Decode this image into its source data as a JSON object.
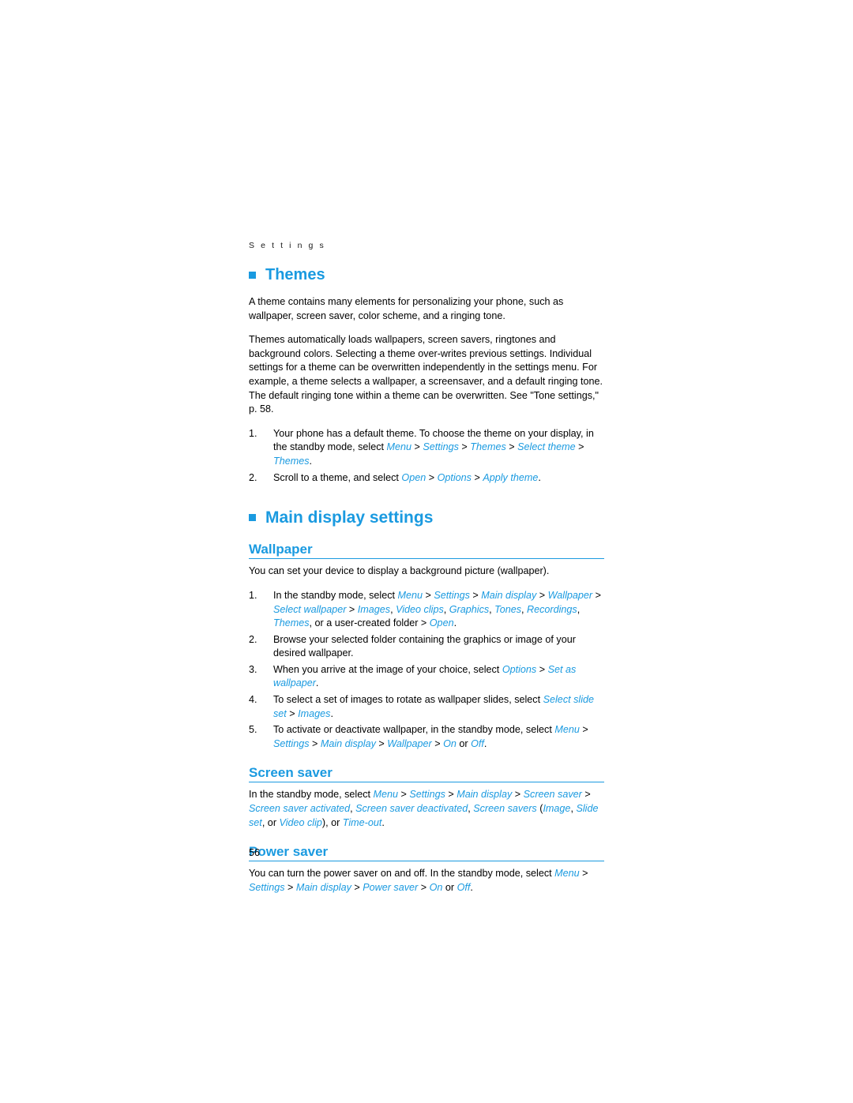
{
  "page": {
    "running_head": "S e t t i n g s",
    "page_number": "56",
    "accent_color": "#1a9ae0"
  },
  "themes": {
    "heading": "Themes",
    "para1": "A theme contains many elements for personalizing your phone, such as wallpaper, screen saver, color scheme, and a ringing tone.",
    "para2": "Themes automatically loads wallpapers, screen savers, ringtones and background colors. Selecting a theme over-writes previous settings. Individual settings for a theme can be overwritten independently in the settings menu. For example, a theme selects a wallpaper, a screensaver, and a default ringing tone. The default ringing tone within a theme can be overwritten. See \"Tone settings,\" p. 58.",
    "steps": [
      {
        "num": "1.",
        "parts": [
          {
            "t": "Your phone has a default theme. To choose the theme on your display, in the standby mode, select ",
            "style": "plain"
          },
          {
            "t": "Menu",
            "style": "link"
          },
          {
            "t": " > ",
            "style": "plain"
          },
          {
            "t": "Settings",
            "style": "link"
          },
          {
            "t": " > ",
            "style": "plain"
          },
          {
            "t": "Themes",
            "style": "link"
          },
          {
            "t": " > ",
            "style": "plain"
          },
          {
            "t": "Select theme",
            "style": "link"
          },
          {
            "t": " > ",
            "style": "plain"
          },
          {
            "t": "Themes",
            "style": "link"
          },
          {
            "t": ".",
            "style": "plain"
          }
        ]
      },
      {
        "num": "2.",
        "parts": [
          {
            "t": "Scroll to a theme, and select ",
            "style": "plain"
          },
          {
            "t": "Open",
            "style": "link"
          },
          {
            "t": " > ",
            "style": "plain"
          },
          {
            "t": "Options",
            "style": "link"
          },
          {
            "t": " > ",
            "style": "plain"
          },
          {
            "t": "Apply theme",
            "style": "link"
          },
          {
            "t": ".",
            "style": "plain"
          }
        ]
      }
    ]
  },
  "main_display": {
    "heading": "Main display settings",
    "wallpaper": {
      "heading": "Wallpaper",
      "para1": "You can set your device to display a background picture (wallpaper).",
      "steps": [
        {
          "num": "1.",
          "parts": [
            {
              "t": "In the standby mode, select ",
              "style": "plain"
            },
            {
              "t": "Menu",
              "style": "link"
            },
            {
              "t": " > ",
              "style": "plain"
            },
            {
              "t": "Settings",
              "style": "link"
            },
            {
              "t": " > ",
              "style": "plain"
            },
            {
              "t": "Main display",
              "style": "link"
            },
            {
              "t": " > ",
              "style": "plain"
            },
            {
              "t": "Wallpaper",
              "style": "link"
            },
            {
              "t": " > ",
              "style": "plain"
            },
            {
              "t": "Select wallpaper",
              "style": "link"
            },
            {
              "t": " > ",
              "style": "plain"
            },
            {
              "t": "Images",
              "style": "link"
            },
            {
              "t": ", ",
              "style": "plain"
            },
            {
              "t": "Video clips",
              "style": "link"
            },
            {
              "t": ", ",
              "style": "plain"
            },
            {
              "t": "Graphics",
              "style": "link"
            },
            {
              "t": ", ",
              "style": "plain"
            },
            {
              "t": "Tones",
              "style": "link"
            },
            {
              "t": ", ",
              "style": "plain"
            },
            {
              "t": "Recordings",
              "style": "link"
            },
            {
              "t": ", ",
              "style": "plain"
            },
            {
              "t": "Themes",
              "style": "link"
            },
            {
              "t": ", or a user-created folder > ",
              "style": "plain"
            },
            {
              "t": "Open",
              "style": "link"
            },
            {
              "t": ".",
              "style": "plain"
            }
          ]
        },
        {
          "num": "2.",
          "parts": [
            {
              "t": "Browse your selected folder containing the graphics or image of your desired wallpaper.",
              "style": "plain"
            }
          ]
        },
        {
          "num": "3.",
          "parts": [
            {
              "t": "When you arrive at the image of your choice, select ",
              "style": "plain"
            },
            {
              "t": "Options",
              "style": "link"
            },
            {
              "t": " > ",
              "style": "plain"
            },
            {
              "t": "Set as wallpaper",
              "style": "link"
            },
            {
              "t": ".",
              "style": "plain"
            }
          ]
        },
        {
          "num": "4.",
          "parts": [
            {
              "t": "To select a set of images to rotate as wallpaper slides, select ",
              "style": "plain"
            },
            {
              "t": "Select slide set",
              "style": "link"
            },
            {
              "t": " > ",
              "style": "plain"
            },
            {
              "t": "Images",
              "style": "link"
            },
            {
              "t": ".",
              "style": "plain"
            }
          ]
        },
        {
          "num": "5.",
          "parts": [
            {
              "t": "To activate or deactivate wallpaper, in the standby mode, select ",
              "style": "plain"
            },
            {
              "t": "Menu",
              "style": "link"
            },
            {
              "t": " > ",
              "style": "plain"
            },
            {
              "t": "Settings",
              "style": "link"
            },
            {
              "t": " > ",
              "style": "plain"
            },
            {
              "t": "Main display",
              "style": "link"
            },
            {
              "t": " > ",
              "style": "plain"
            },
            {
              "t": "Wallpaper",
              "style": "link"
            },
            {
              "t": " > ",
              "style": "plain"
            },
            {
              "t": "On",
              "style": "link"
            },
            {
              "t": " or ",
              "style": "plain"
            },
            {
              "t": "Off",
              "style": "link"
            },
            {
              "t": ".",
              "style": "plain"
            }
          ]
        }
      ]
    },
    "screen_saver": {
      "heading": "Screen saver",
      "parts": [
        {
          "t": "In the standby mode, select ",
          "style": "plain"
        },
        {
          "t": "Menu",
          "style": "link"
        },
        {
          "t": " > ",
          "style": "plain"
        },
        {
          "t": "Settings",
          "style": "link"
        },
        {
          "t": " > ",
          "style": "plain"
        },
        {
          "t": "Main display",
          "style": "link"
        },
        {
          "t": " > ",
          "style": "plain"
        },
        {
          "t": "Screen saver",
          "style": "link"
        },
        {
          "t": " > ",
          "style": "plain"
        },
        {
          "t": "Screen saver activated",
          "style": "link"
        },
        {
          "t": ", ",
          "style": "plain"
        },
        {
          "t": "Screen saver deactivated",
          "style": "link"
        },
        {
          "t": ", ",
          "style": "plain"
        },
        {
          "t": "Screen savers",
          "style": "link"
        },
        {
          "t": " (",
          "style": "plain"
        },
        {
          "t": "Image",
          "style": "link"
        },
        {
          "t": ", ",
          "style": "plain"
        },
        {
          "t": "Slide set",
          "style": "link"
        },
        {
          "t": ", or ",
          "style": "plain"
        },
        {
          "t": "Video clip",
          "style": "link"
        },
        {
          "t": "), or ",
          "style": "plain"
        },
        {
          "t": "Time-out",
          "style": "link"
        },
        {
          "t": ".",
          "style": "plain"
        }
      ]
    },
    "power_saver": {
      "heading": "Power saver",
      "parts": [
        {
          "t": "You can turn the power saver on and off. In the standby mode, select ",
          "style": "plain"
        },
        {
          "t": "Menu",
          "style": "link"
        },
        {
          "t": " > ",
          "style": "plain"
        },
        {
          "t": "Settings",
          "style": "link"
        },
        {
          "t": " > ",
          "style": "plain"
        },
        {
          "t": "Main display",
          "style": "link"
        },
        {
          "t": " > ",
          "style": "plain"
        },
        {
          "t": "Power saver",
          "style": "link"
        },
        {
          "t": " > ",
          "style": "plain"
        },
        {
          "t": "On",
          "style": "link"
        },
        {
          "t": " or ",
          "style": "plain"
        },
        {
          "t": "Off",
          "style": "link"
        },
        {
          "t": ".",
          "style": "plain"
        }
      ]
    }
  }
}
